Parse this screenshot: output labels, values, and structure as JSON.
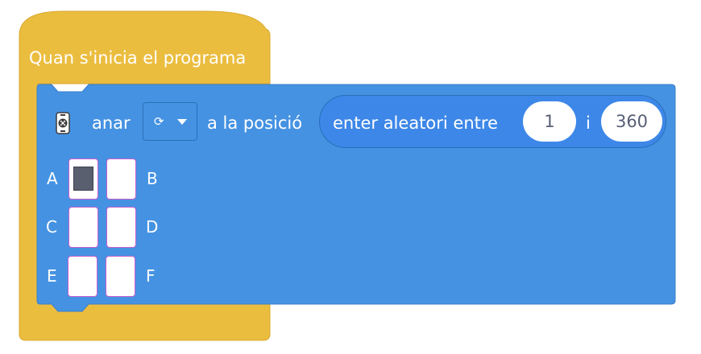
{
  "hat_block": {
    "label": "Quan s'inicia el programa",
    "color": "#ebbd3f"
  },
  "command_block": {
    "color": "#4592e2",
    "icon": "motor-icon",
    "label_go": "anar",
    "direction_dropdown": {
      "icon": "clockwise-icon",
      "glyph": "⟳"
    },
    "label_position": "a la posició",
    "reporter": {
      "label": "enter aleatori entre",
      "min": "1",
      "joiner": "i",
      "max": "360"
    }
  },
  "ports": [
    {
      "label": "A",
      "selected": true
    },
    {
      "label": "B",
      "selected": false
    },
    {
      "label": "C",
      "selected": false
    },
    {
      "label": "D",
      "selected": false
    },
    {
      "label": "E",
      "selected": false
    },
    {
      "label": "F",
      "selected": false
    }
  ]
}
